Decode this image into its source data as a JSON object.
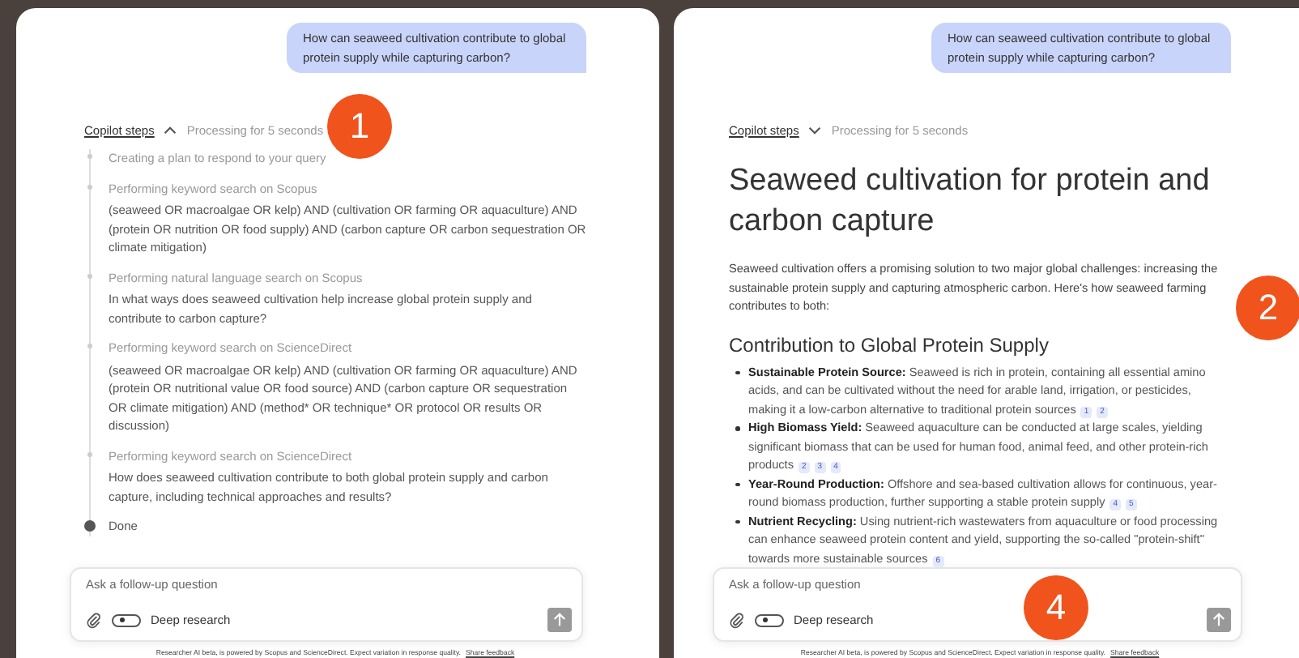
{
  "panels": [
    {
      "question": "How can seaweed cultivation contribute to global protein supply while capturing carbon?",
      "steps_label": "Copilot steps",
      "steps_expanded": true,
      "status": "Processing for 5 seconds",
      "steps": [
        {
          "title": "Creating a plan to respond to your query"
        },
        {
          "title": "Performing keyword search on Scopus",
          "query": "(seaweed OR macroalgae OR kelp) AND (cultivation OR farming OR aquaculture) AND (protein OR nutrition OR food supply) AND (carbon capture OR carbon  sequestration OR climate mitigation)"
        },
        {
          "title": "Performing natural language search on Scopus",
          "query": "In what ways does seaweed cultivation help increase global protein supply and contribute to carbon capture?"
        },
        {
          "title": "Performing keyword search on ScienceDirect",
          "query": "(seaweed OR macroalgae OR kelp) AND (cultivation OR farming OR aquaculture) AND (protein OR nutritional value OR food source) AND (carbon capture OR  sequestration OR climate mitigation) AND (method* OR technique* OR  protocol OR results OR discussion)"
        },
        {
          "title": "Performing keyword search on ScienceDirect",
          "query": "How does seaweed cultivation contribute to both global protein supply and  carbon capture, including technical approaches and results?"
        }
      ],
      "done_label": "Done",
      "input": {
        "placeholder": "Ask a follow-up question",
        "toggle_label": "Deep research",
        "toggle_on": false
      },
      "footer": "Researcher AI beta, is powered by Scopus and ScienceDirect. Expect variation in response quality.",
      "feedback_link": "Share feedback"
    },
    {
      "question": "How can seaweed cultivation contribute to global protein supply while capturing carbon?",
      "steps_label": "Copilot steps",
      "steps_expanded": false,
      "status": "Processing for 5 seconds",
      "answer": {
        "title": "Seaweed cultivation for protein and carbon capture",
        "intro": "Seaweed cultivation offers a promising solution to two major global  challenges: increasing the sustainable protein supply and capturing  atmospheric carbon. Here's how seaweed farming contributes to both:",
        "section": "Contribution to Global Protein Supply",
        "bullets": [
          {
            "label": "Sustainable Protein Source:",
            "text": "Seaweed is rich in protein, containing all essential amino acids, and can be cultivated without the need for arable land, irrigation, or pesticides, making it a low-carbon alternative to traditional protein sources",
            "citations": [
              "1",
              "2"
            ]
          },
          {
            "label": "High Biomass Yield:",
            "text": "Seaweed aquaculture can be  conducted at large scales, yielding significant biomass that can be used for human food, animal feed, and other protein-rich products",
            "citations": [
              "2",
              "3",
              "4"
            ]
          },
          {
            "label": "Year-Round Production:",
            "text": "Offshore and sea-based  cultivation allows for continuous, year-round biomass production,  further supporting a stable protein supply",
            "citations": [
              "4",
              "5"
            ]
          },
          {
            "label": "Nutrient Recycling:",
            "text": "Using nutrient-rich wastewaters  from aquaculture or food processing can enhance seaweed protein content  and yield, supporting the so-called \"protein-shift\" towards more  sustainable sources",
            "citations": [
              "6"
            ]
          }
        ]
      },
      "input": {
        "placeholder": "Ask a follow-up question",
        "toggle_label": "Deep research",
        "toggle_on": false
      },
      "footer": "Researcher AI beta, is powered by Scopus and ScienceDirect. Expect variation in response quality.",
      "feedback_link": "Share feedback"
    }
  ],
  "markers": [
    {
      "label": "1"
    },
    {
      "label": "2"
    },
    {
      "label": "4"
    }
  ]
}
